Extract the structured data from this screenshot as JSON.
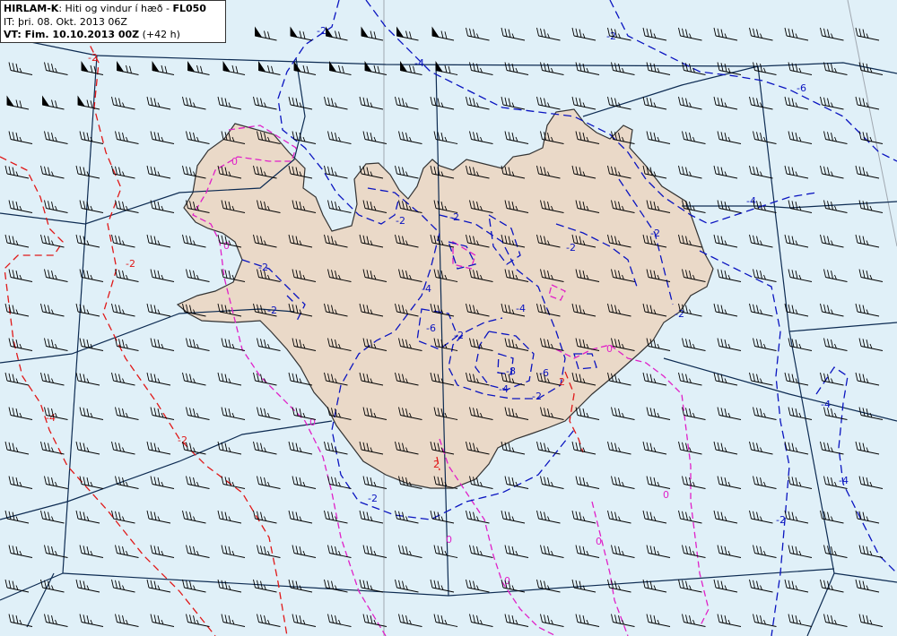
{
  "header": {
    "model": "HIRLAM-K",
    "description": ": Hiti og vindur í hæð - ",
    "level": "FL050",
    "issue_prefix": "IT: ",
    "issue_time": "þri. 08. Okt. 2013 06Z",
    "valid_prefix": "VT: ",
    "valid_time": "Fim. 10.10.2013 00Z",
    "lead": " (+42 h)"
  },
  "colors": {
    "sea": "#e0f0f8",
    "land": "#ead9c8",
    "coast": "#333333",
    "grid": "#0d2b52",
    "meridian": "#a0a8b0",
    "cold": "#0a14c0",
    "zero": "#e020c8",
    "warm": "#e01818",
    "barb": "#000000"
  },
  "contour_labels": {
    "cold": [
      "-4",
      "-2",
      "-6",
      "-4",
      "-2",
      "-2",
      "-2",
      "-2",
      "-2",
      "-2",
      "-4",
      "-6",
      "-2",
      "-4",
      "-8",
      "-6",
      "-2",
      "-4",
      "-4",
      "-2",
      "-2",
      "-2",
      "-2",
      "-4"
    ],
    "zero": [
      "0",
      "0",
      "0",
      "0",
      "0",
      "0",
      "0",
      "0"
    ],
    "warm": [
      "-2",
      "-2",
      "2",
      "-4",
      "-2",
      "2"
    ]
  }
}
